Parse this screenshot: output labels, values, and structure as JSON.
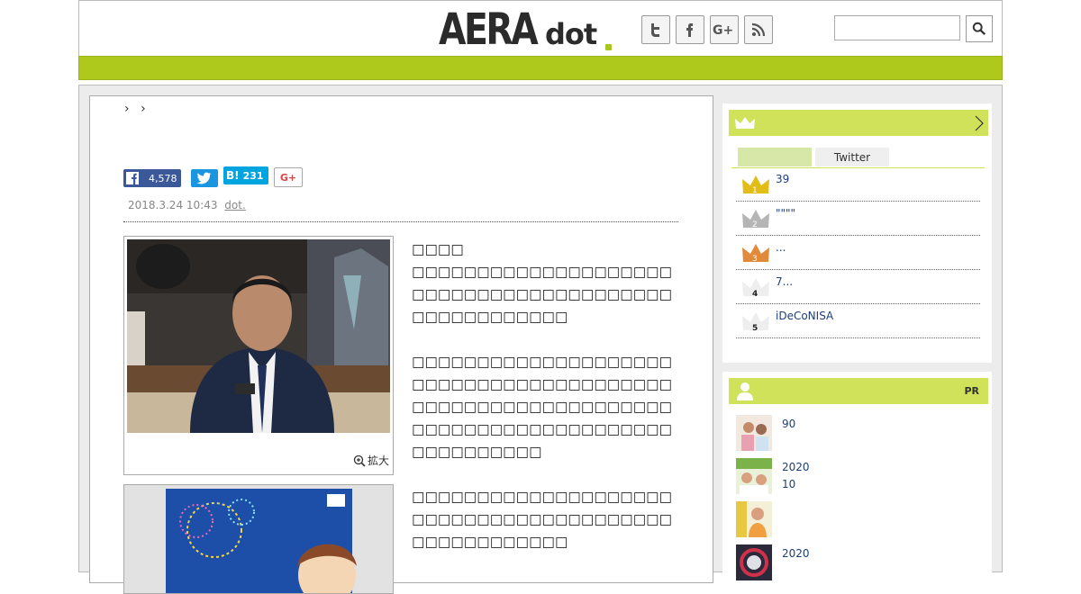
{
  "header": {
    "logo_main": "AERA",
    "logo_sub": "dot",
    "search": {
      "placeholder": ""
    },
    "social_icons": [
      "twitter-icon",
      "facebook-icon",
      "google-plus-icon",
      "rss-icon"
    ]
  },
  "article": {
    "breadcrumb_sep": "›",
    "share": {
      "facebook_count": "4,578",
      "hatena_label": "B!",
      "hatena_count": "231",
      "gplus_label": "G+"
    },
    "date": "2018.3.24 10:43",
    "source": "dot.",
    "zoom_label": "拡大",
    "heading": "□□□□",
    "paragraphs": [
      "□□□□□□□□□□□□□□□□□□□□□□□□□□□□□□□□□□□□□□□□□□□□□□□□□□□□",
      "□□□□□□□□□□□□□□□□□□□□□□□□□□□□□□□□□□□□□□□□□□□□□□□□□□□□□□□□□□□□□□□□□□□□□□□□□□□□□□□□□□□□□□□□□□",
      "□□□□□□□□□□□□□□□□□□□□□□□□□□□□□□□□□□□□□□□□□□□□□□□□□□□□"
    ]
  },
  "sidebar": {
    "ranking": {
      "tabs": [
        "",
        "Twitter"
      ],
      "items": [
        {
          "rank": "1",
          "text": "39"
        },
        {
          "rank": "2",
          "text": "\"\"\"\""
        },
        {
          "rank": "3",
          "text": "..."
        },
        {
          "rank": "4",
          "text": "7..."
        },
        {
          "rank": "5",
          "text": "iDeCoNISA"
        }
      ]
    },
    "pr": {
      "label": "PR",
      "items": [
        {
          "line1": "90",
          "line2": ""
        },
        {
          "line1": "2020",
          "line2": "10"
        },
        {
          "line1": "",
          "line2": ""
        },
        {
          "line1": "2020",
          "line2": ""
        }
      ]
    }
  },
  "colors": {
    "accent_green": "#aec81c",
    "sidebar_green": "#cfe25a",
    "gold": "#e2bd17",
    "silver": "#b5b5b5",
    "bronze": "#e08a3a"
  }
}
